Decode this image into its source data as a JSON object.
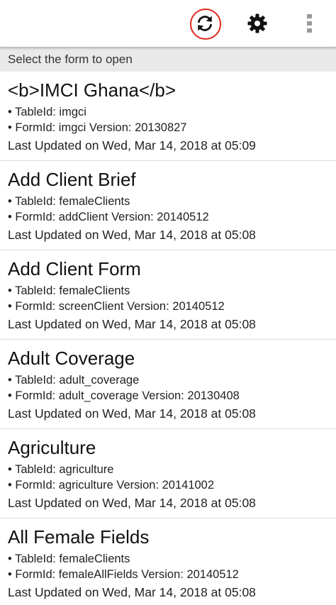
{
  "toolbar": {
    "sync_icon": "sync-icon",
    "settings_icon": "gear-icon",
    "overflow_icon": "overflow-menu-icon",
    "highlight_color": "#e0271f"
  },
  "header": {
    "subtitle": "Select the form to open"
  },
  "forms": [
    {
      "title": "<b>IMCI Ghana</b>",
      "table_id": "• TableId: imgci",
      "form_id": "• FormId: imgci Version: 20130827",
      "updated": "Last Updated on Wed, Mar 14, 2018 at 05:09"
    },
    {
      "title": "Add Client Brief",
      "table_id": "• TableId: femaleClients",
      "form_id": "• FormId: addClient Version: 20140512",
      "updated": "Last Updated on Wed, Mar 14, 2018 at 05:08"
    },
    {
      "title": "Add Client Form",
      "table_id": "• TableId: femaleClients",
      "form_id": "• FormId: screenClient Version: 20140512",
      "updated": "Last Updated on Wed, Mar 14, 2018 at 05:08"
    },
    {
      "title": "Adult Coverage",
      "table_id": "• TableId: adult_coverage",
      "form_id": "• FormId: adult_coverage Version: 20130408",
      "updated": "Last Updated on Wed, Mar 14, 2018 at 05:08"
    },
    {
      "title": "Agriculture",
      "table_id": "• TableId: agriculture",
      "form_id": "• FormId: agriculture Version: 20141002",
      "updated": "Last Updated on Wed, Mar 14, 2018 at 05:08"
    },
    {
      "title": "All Female Fields",
      "table_id": "• TableId: femaleClients",
      "form_id": "• FormId: femaleAllFields Version: 20140512",
      "updated": "Last Updated on Wed, Mar 14, 2018 at 05:08"
    }
  ]
}
